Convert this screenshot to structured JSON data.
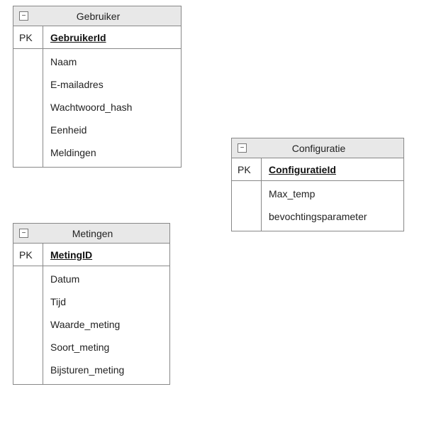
{
  "entities": [
    {
      "id": "gebruiker",
      "title": "Gebruiker",
      "pk_label": "PK",
      "pk_name": "GebruikerId",
      "attributes": [
        "Naam",
        "E-mailadres",
        "Wachtwoord_hash",
        "Eenheid",
        "Meldingen"
      ]
    },
    {
      "id": "metingen",
      "title": "Metingen",
      "pk_label": "PK",
      "pk_name": "MetingID",
      "attributes": [
        "Datum",
        "Tijd",
        "Waarde_meting",
        "Soort_meting",
        "Bijsturen_meting"
      ]
    },
    {
      "id": "config",
      "title": "Configuratie",
      "pk_label": "PK",
      "pk_name": "ConfiguratieId",
      "attributes": [
        "Max_temp",
        "bevochtingsparameter"
      ]
    }
  ],
  "toggle_glyph": "−"
}
